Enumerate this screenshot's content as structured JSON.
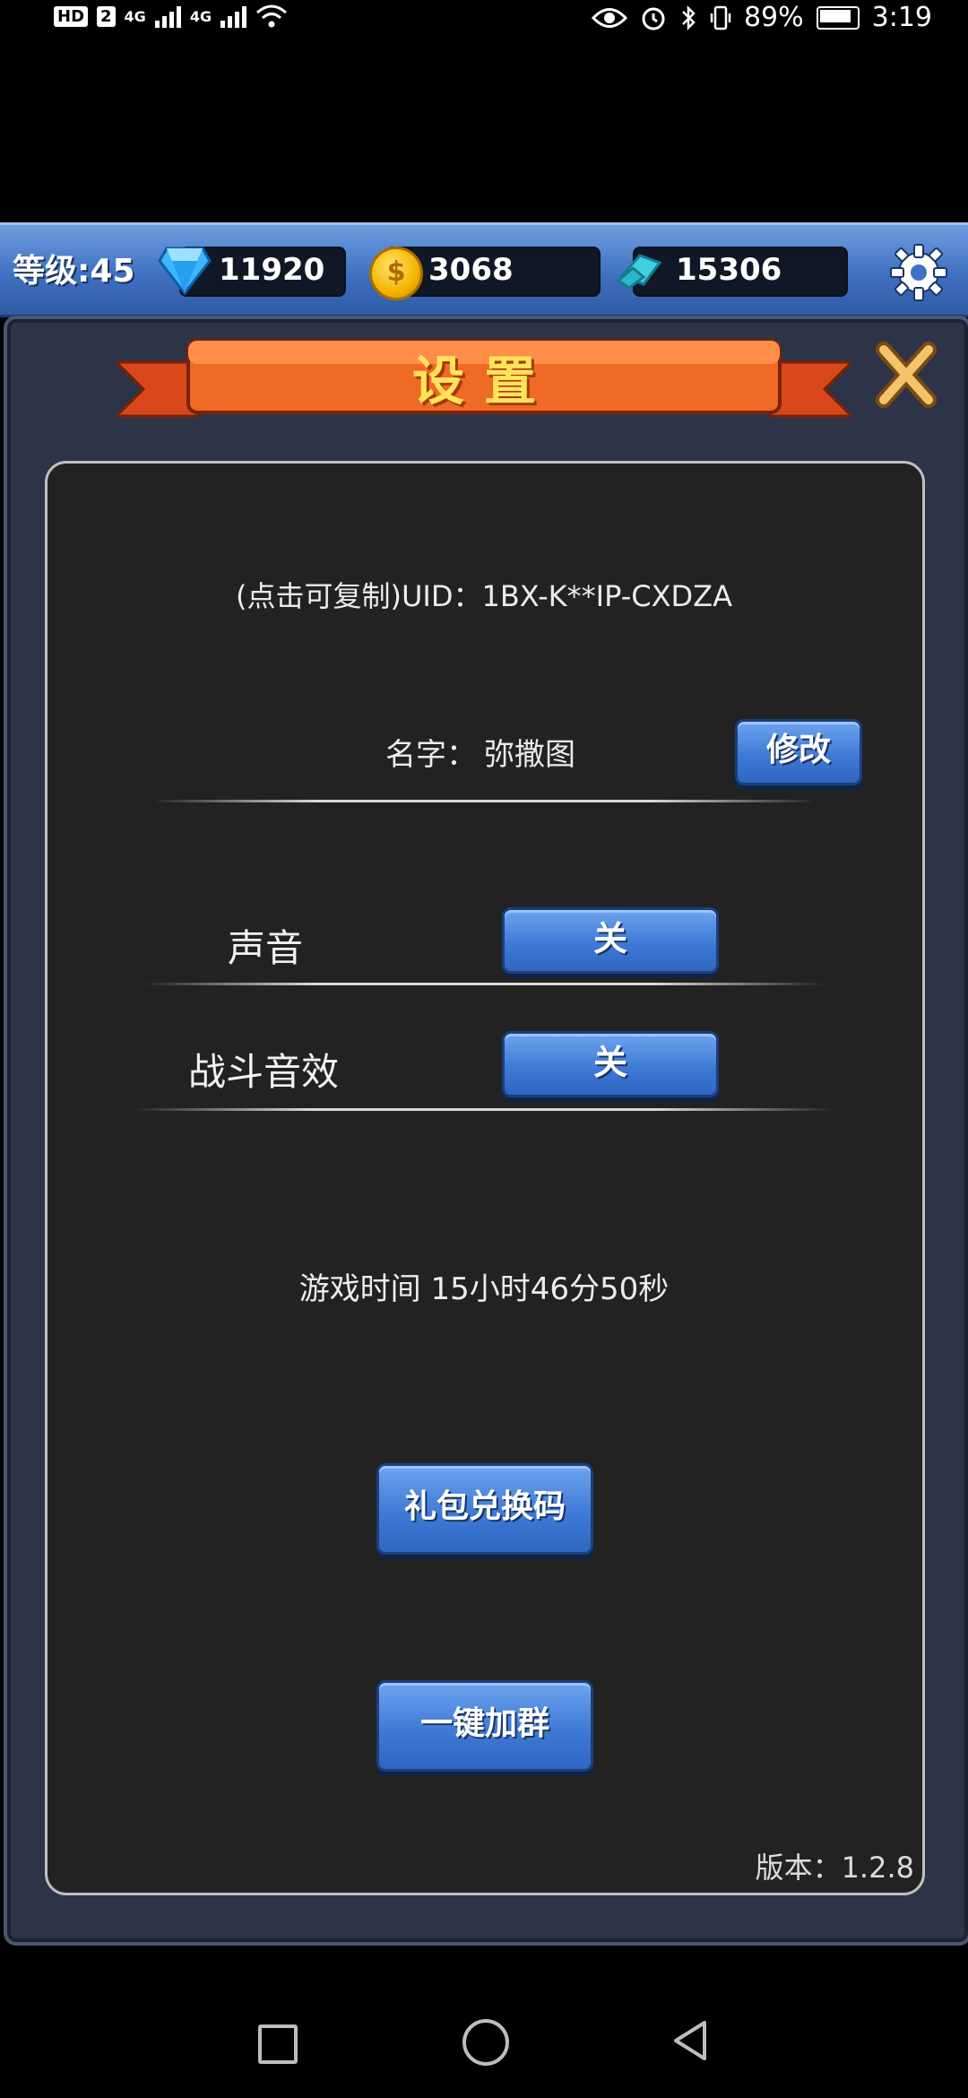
{
  "status_bar": {
    "badge_hd": "HD",
    "badge_sim": "2",
    "net1": "4G",
    "net2": "4G",
    "battery": "89%",
    "time": "3:19"
  },
  "hud": {
    "level": "等级:45",
    "gems": "11920",
    "coins": "3068",
    "crystals": "15306"
  },
  "dialog": {
    "title": "设置",
    "uid_text": "(点击可复制)UID：1BX-K**IP-CXDZA",
    "name_label": "名字：",
    "name_value": "弥撒图",
    "edit_label": "修改",
    "sound_label": "声音",
    "sound_toggle": "关",
    "battle_sfx_label": "战斗音效",
    "battle_sfx_toggle": "关",
    "playtime": "游戏时间 15小时46分50秒",
    "gift_code_label": "礼包兑换码",
    "join_group_label": "一键加群",
    "version": "版本：1.2.8"
  },
  "colors": {
    "hud_blue": "#3f71c2",
    "button_blue": "#3f7ad6",
    "banner_orange": "#e8561c",
    "title_yellow": "#ffe45a",
    "panel_bg": "#222222"
  },
  "icons": [
    "gem-icon",
    "coin-icon",
    "crystal-icon",
    "gear-icon",
    "close-icon",
    "square-nav-icon",
    "circle-nav-icon",
    "back-nav-icon"
  ]
}
